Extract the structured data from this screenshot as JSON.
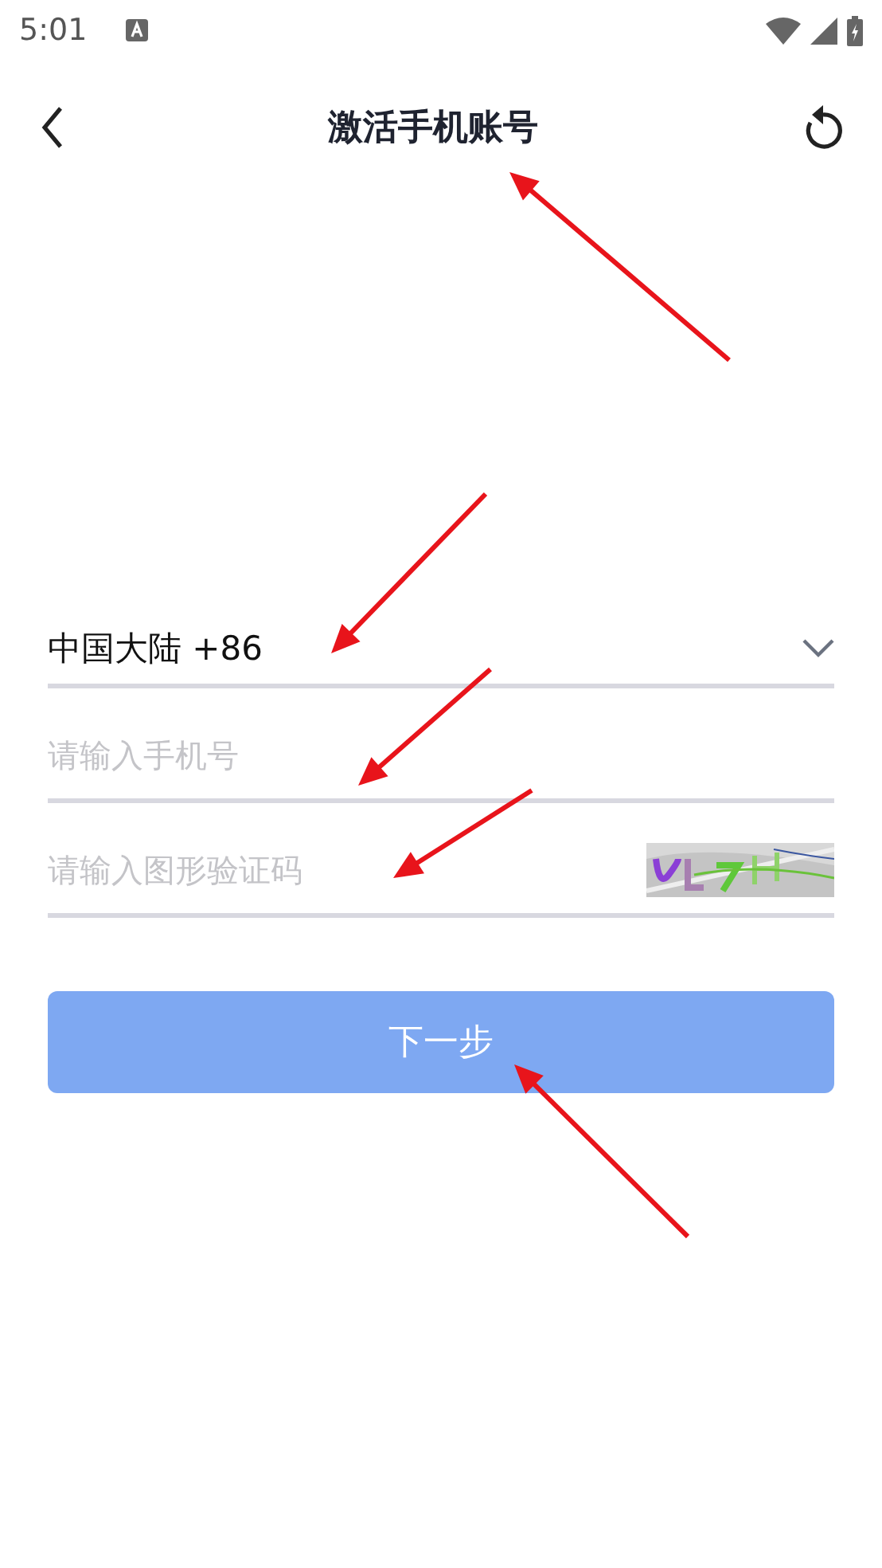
{
  "status_bar": {
    "time": "5:01"
  },
  "header": {
    "title": "激活手机账号"
  },
  "form": {
    "region": {
      "value": "中国大陆 +86"
    },
    "phone": {
      "placeholder": "请输入手机号"
    },
    "captcha": {
      "placeholder": "请输入图形验证码"
    }
  },
  "next_button": {
    "label": "下一步",
    "disabled": true
  }
}
